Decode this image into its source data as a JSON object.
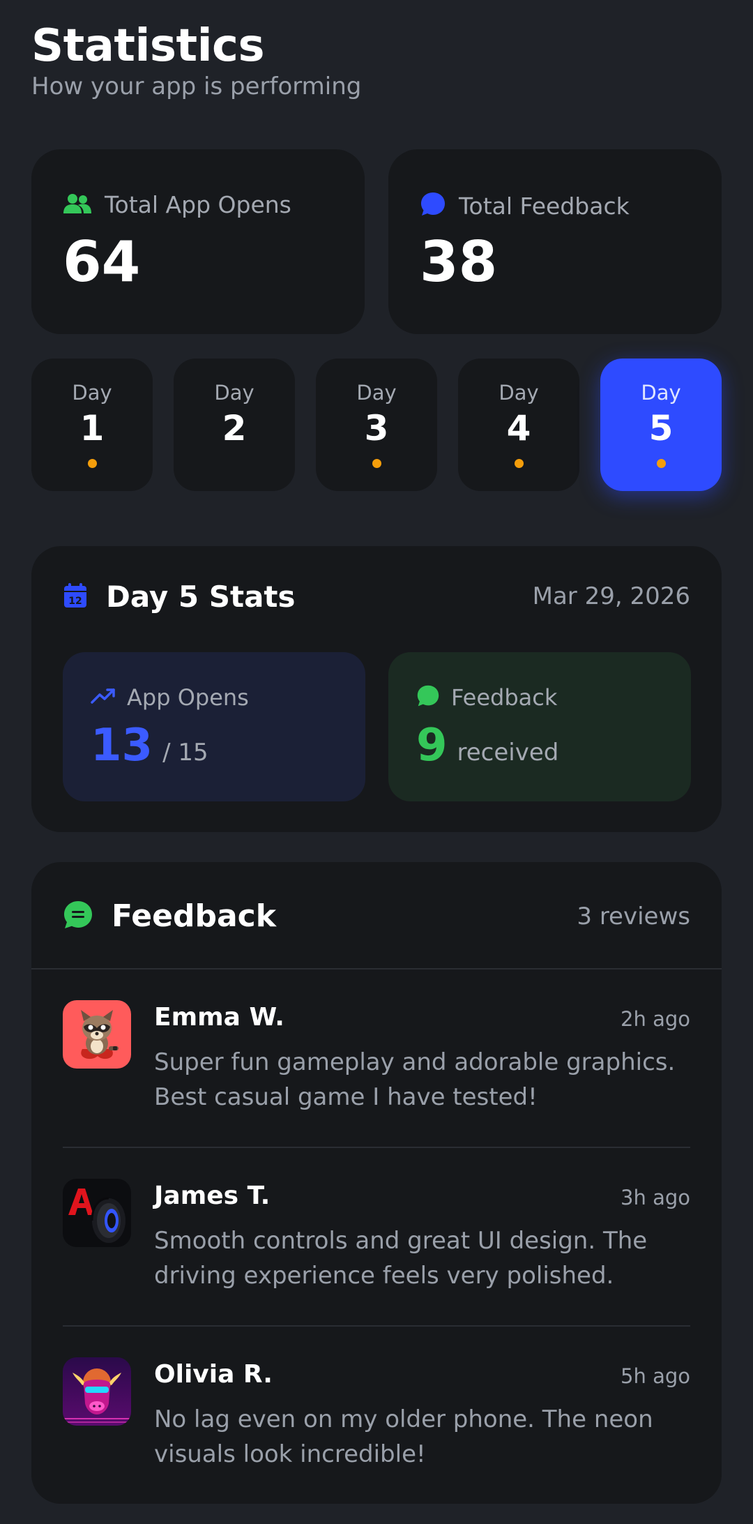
{
  "header": {
    "title": "Statistics",
    "subtitle": "How your app is performing"
  },
  "totals": {
    "opens_label": "Total App Opens",
    "opens_value": "64",
    "opens_icon": "users-icon",
    "feedback_label": "Total Feedback",
    "feedback_value": "38",
    "feedback_icon": "chat-bubble-icon"
  },
  "days": [
    {
      "label": "Day",
      "number": "1",
      "has_dot": true,
      "selected": false
    },
    {
      "label": "Day",
      "number": "2",
      "has_dot": false,
      "selected": false
    },
    {
      "label": "Day",
      "number": "3",
      "has_dot": true,
      "selected": false
    },
    {
      "label": "Day",
      "number": "4",
      "has_dot": true,
      "selected": false
    },
    {
      "label": "Day",
      "number": "5",
      "has_dot": true,
      "selected": true
    }
  ],
  "day_stats": {
    "title": "Day 5 Stats",
    "date": "Mar 29, 2026",
    "opens_label": "App Opens",
    "opens_value": "13",
    "opens_total": "/ 15",
    "feedback_label": "Feedback",
    "feedback_value": "9",
    "feedback_suffix": "received"
  },
  "feedback": {
    "title": "Feedback",
    "count": "3 reviews",
    "reviews": [
      {
        "name": "Emma W.",
        "time": "2h ago",
        "text": "Super fun gameplay and adorable graphics. Best casual game I have tested!",
        "avatar": "raccoon-game-icon"
      },
      {
        "name": "James T.",
        "time": "3h ago",
        "text": "Smooth controls and great UI design. The driving experience feels very polished.",
        "avatar": "racing-tire-icon"
      },
      {
        "name": "Olivia R.",
        "time": "5h ago",
        "text": "No lag even on my older phone. The neon visuals look incredible!",
        "avatar": "neon-bull-icon"
      }
    ]
  },
  "colors": {
    "background": "#1f2228",
    "card": "#16181b",
    "accent_blue": "#2e4bff",
    "accent_green": "#34c759",
    "dot_orange": "#f59e0b"
  }
}
